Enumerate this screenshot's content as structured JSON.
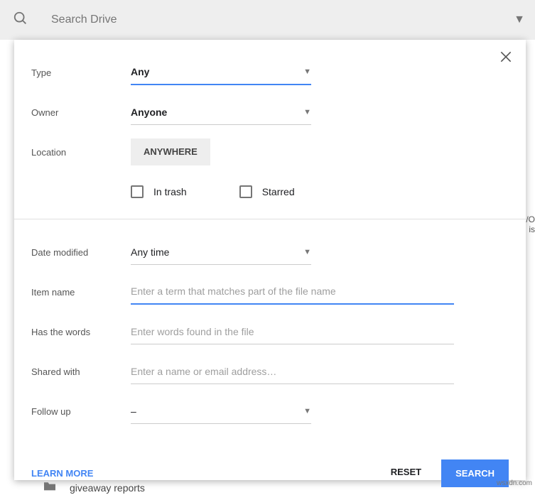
{
  "search": {
    "placeholder": "Search Drive"
  },
  "labels": {
    "type": "Type",
    "owner": "Owner",
    "location": "Location",
    "date_modified": "Date modified",
    "item_name": "Item name",
    "has_words": "Has the words",
    "shared_with": "Shared with",
    "follow_up": "Follow up"
  },
  "values": {
    "type": "Any",
    "owner": "Anyone",
    "location_btn": "ANYWHERE",
    "in_trash": "In trash",
    "starred": "Starred",
    "date_modified": "Any time",
    "follow_up": "–"
  },
  "placeholders": {
    "item_name": "Enter a term that matches part of the file name",
    "has_words": "Enter words found in the file",
    "shared_with": "Enter a name or email address…"
  },
  "footer": {
    "learn_more": "LEARN MORE",
    "reset": "RESET",
    "search": "SEARCH"
  },
  "behind": {
    "folder_name": "giveaway reports"
  },
  "watermark": "wsxdn.com",
  "edge": "/O\nis"
}
